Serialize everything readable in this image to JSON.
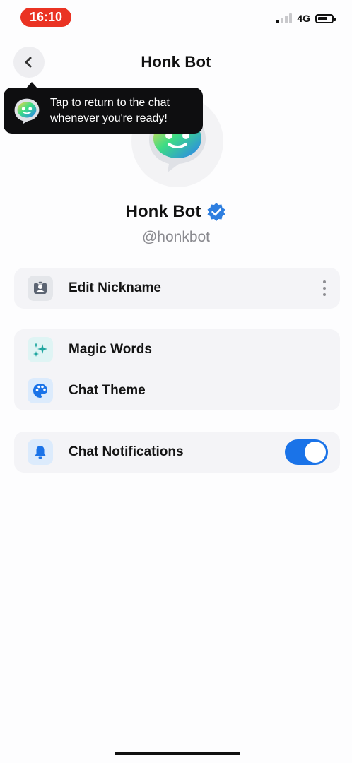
{
  "status_bar": {
    "time": "16:10",
    "network": "4G",
    "signal_bars_active": 1,
    "signal_bars_total": 4,
    "battery_level": 0.6
  },
  "header": {
    "title": "Honk Bot",
    "back_icon": "chevron-left-icon"
  },
  "tooltip": {
    "line1": "Tap to return to the chat",
    "line2": "whenever you're ready!"
  },
  "profile": {
    "name": "Honk Bot",
    "handle": "@honkbot",
    "verified_icon": "verified-badge-icon"
  },
  "menu": {
    "nickname": {
      "label": "Edit Nickname",
      "icon": "id-card-icon"
    },
    "magic_words": {
      "label": "Magic Words",
      "icon": "sparkles-icon"
    },
    "chat_theme": {
      "label": "Chat Theme",
      "icon": "palette-icon"
    },
    "notifications": {
      "label": "Chat Notifications",
      "icon": "bell-icon",
      "enabled": true
    }
  },
  "colors": {
    "accent": "#1a73e8",
    "status_time_bg": "#ea3323",
    "card_bg": "#f4f4f7",
    "tooltip_bg": "#0e0e10"
  }
}
